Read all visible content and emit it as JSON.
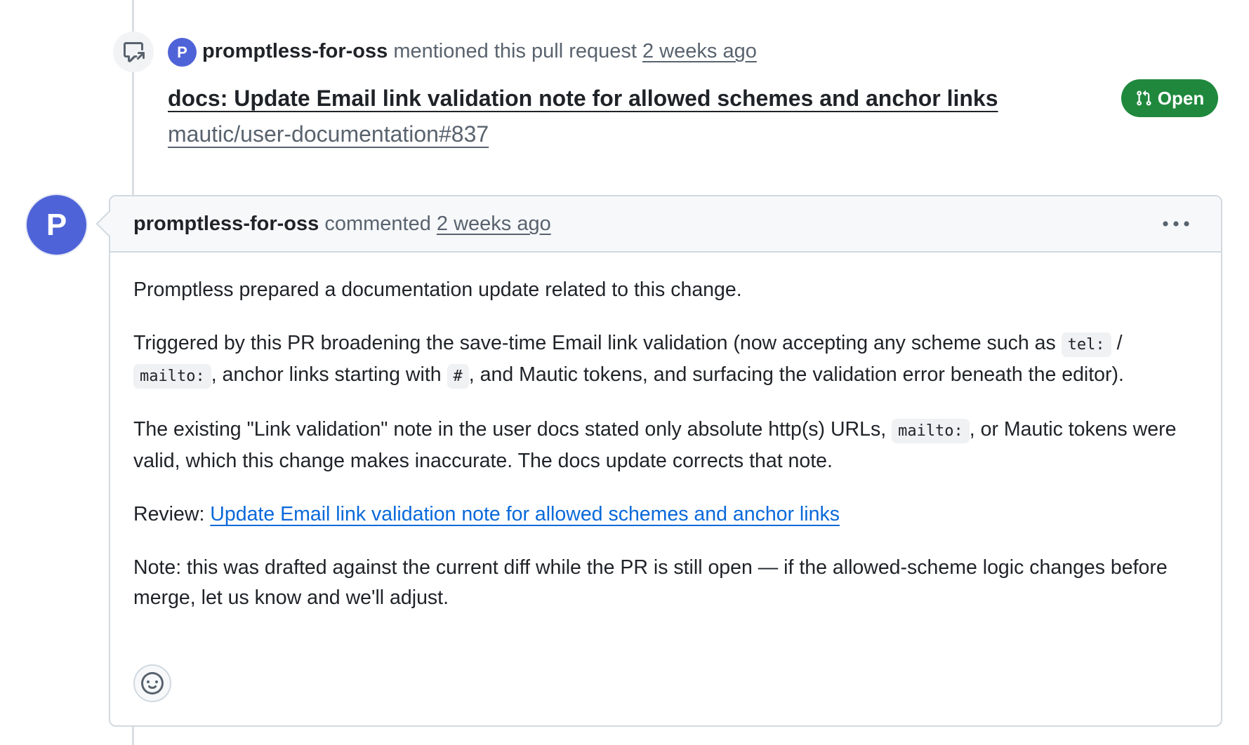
{
  "mention_event": {
    "avatar_initial": "P",
    "actor": "promptless-for-oss",
    "action": "mentioned this pull request",
    "timestamp": "2 weeks ago",
    "ref_title": "docs: Update Email link validation note for allowed schemes and anchor links",
    "ref_id": "mautic/user-documentation#837",
    "state_label": "Open",
    "state_color": "#1f883d"
  },
  "comment": {
    "avatar_initial": "P",
    "author": "promptless-for-oss",
    "action": "commented",
    "timestamp": "2 weeks ago",
    "menu_icon": "kebab-horizontal-icon",
    "body": {
      "p1": "Promptless prepared a documentation update related to this change.",
      "p2_part1": "Triggered by this PR broadening the save-time Email link validation (now accepting any scheme such as ",
      "p2_code1": "tel:",
      "p2_sep": " / ",
      "p2_code2": "mailto:",
      "p2_part2": ", anchor links starting with ",
      "p2_code3": "#",
      "p2_part3": ", and Mautic tokens, and surfacing the validation error beneath the editor).",
      "p3_part1": "The existing \"Link validation\" note in the user docs stated only absolute http(s) URLs, ",
      "p3_code1": "mailto:",
      "p3_part2": ", or Mautic tokens were valid, which this change makes inaccurate. The docs update corrects that note.",
      "p4_label": "Review: ",
      "p4_link": "Update Email link validation note for allowed schemes and anchor links",
      "p5": "Note: this was drafted against the current diff while the PR is still open — if the allowed-scheme logic changes before merge, let us know and we'll adjust."
    },
    "reaction_icon": "smiley-icon"
  },
  "colors": {
    "accent_link": "#0969da",
    "avatar_bg": "#4f63d8",
    "open_green": "#1f883d"
  }
}
